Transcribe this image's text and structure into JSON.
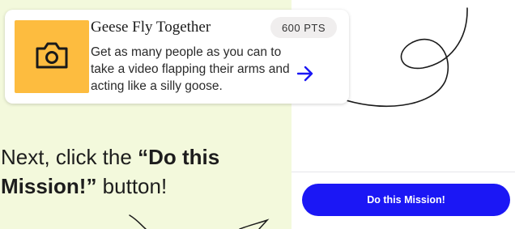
{
  "mission_card": {
    "title": "Geese Fly Together",
    "points": "600 PTS",
    "description": "Get as many people as you can to take a video flapping their arms and acting like a silly goose.",
    "thumbnail_icon": "camera-icon",
    "thumbnail_color": "#fdbc3f",
    "arrow_icon": "arrow-right-icon"
  },
  "instruction": {
    "prefix": "Next, click the ",
    "emphasis": "“Do this Mission!”",
    "suffix": " button!"
  },
  "cta": {
    "label": "Do this Mission!",
    "color": "#1b17f5"
  },
  "colors": {
    "background": "#f3f9dc",
    "accent": "#1b17f5"
  }
}
